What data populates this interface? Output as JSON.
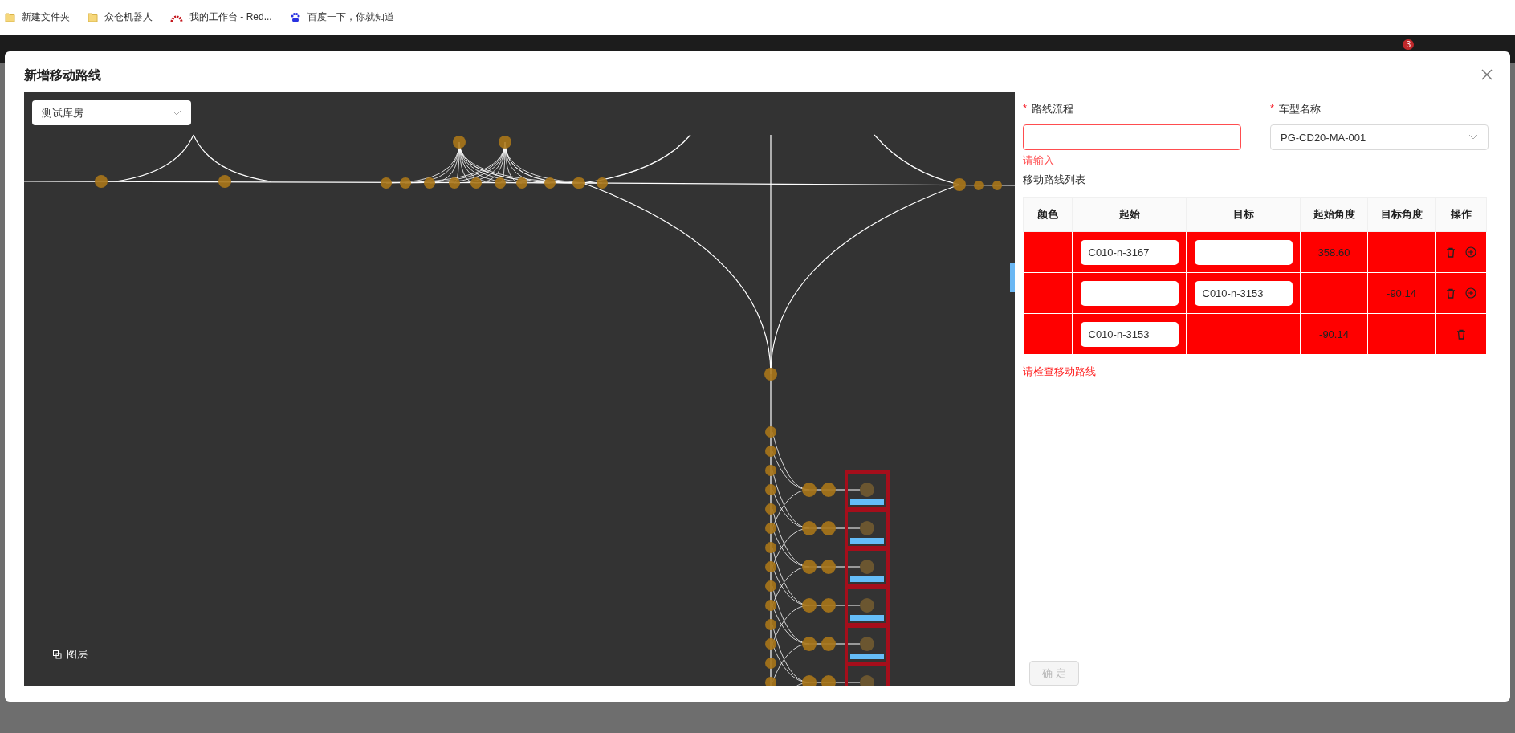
{
  "bookmarks": [
    {
      "kind": "folder",
      "label": "新建文件夹"
    },
    {
      "kind": "folder",
      "label": "众仓机器人"
    },
    {
      "kind": "arc",
      "label": "我的工作台 - Red..."
    },
    {
      "kind": "paw",
      "label": "百度一下，你就知道"
    }
  ],
  "header": {
    "notification_count": "3"
  },
  "dialog": {
    "title": "新增移动路线"
  },
  "map": {
    "warehouse_select": "测试库房",
    "layer_button": "图层"
  },
  "form": {
    "route_field": {
      "mark": "*",
      "label": "路线流程",
      "invalid": true,
      "error": "请输入"
    },
    "vehicle_field": {
      "mark": "*",
      "label": "车型名称",
      "value": "PG-CD20-MA-001"
    }
  },
  "route_list": {
    "title": "移动路线列表",
    "columns": [
      "颜色",
      "起始",
      "目标",
      "起始角度",
      "目标角度",
      "操作"
    ],
    "rows": [
      {
        "color": "#ff0000",
        "start": "C010-n-3167",
        "has_target_input": true,
        "start_angle": "358.60",
        "can_add": true
      },
      {
        "color": "#ff0000",
        "target": "C010-n-3153",
        "has_target_input": true,
        "target_angle": "-90.14",
        "can_add": true
      },
      {
        "color": "#ff0000",
        "start": "C010-n-3153",
        "has_target_input": false,
        "start_angle": "-90.14",
        "can_add": false
      }
    ],
    "error": "请检查移动路线"
  },
  "confirm_button": {
    "label": "确 定",
    "disabled": true
  }
}
